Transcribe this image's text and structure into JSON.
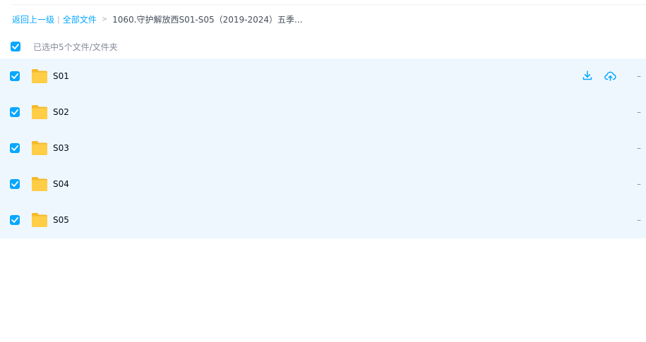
{
  "breadcrumb": {
    "back_label": "返回上一级",
    "separator": "|",
    "all_files_label": "全部文件",
    "arrow": ">",
    "current": "1060.守护解放西S01-S05（2019-2024）五季..."
  },
  "selection": {
    "status_text": "已选中5个文件/文件夹",
    "checked": true
  },
  "files": [
    {
      "name": "S01",
      "type": "folder",
      "checked": true,
      "size": "–"
    },
    {
      "name": "S02",
      "type": "folder",
      "checked": true,
      "size": "–"
    },
    {
      "name": "S03",
      "type": "folder",
      "checked": true,
      "size": "–"
    },
    {
      "name": "S04",
      "type": "folder",
      "checked": true,
      "size": "–"
    },
    {
      "name": "S05",
      "type": "folder",
      "checked": true,
      "size": "–"
    }
  ],
  "row_actions": [
    {
      "icon": "download-icon"
    },
    {
      "icon": "cloud-upload-icon"
    }
  ],
  "colors": {
    "accent": "#06a7ff",
    "row_background": "#eef7fe",
    "folder_yellow": "#ffc93a"
  }
}
